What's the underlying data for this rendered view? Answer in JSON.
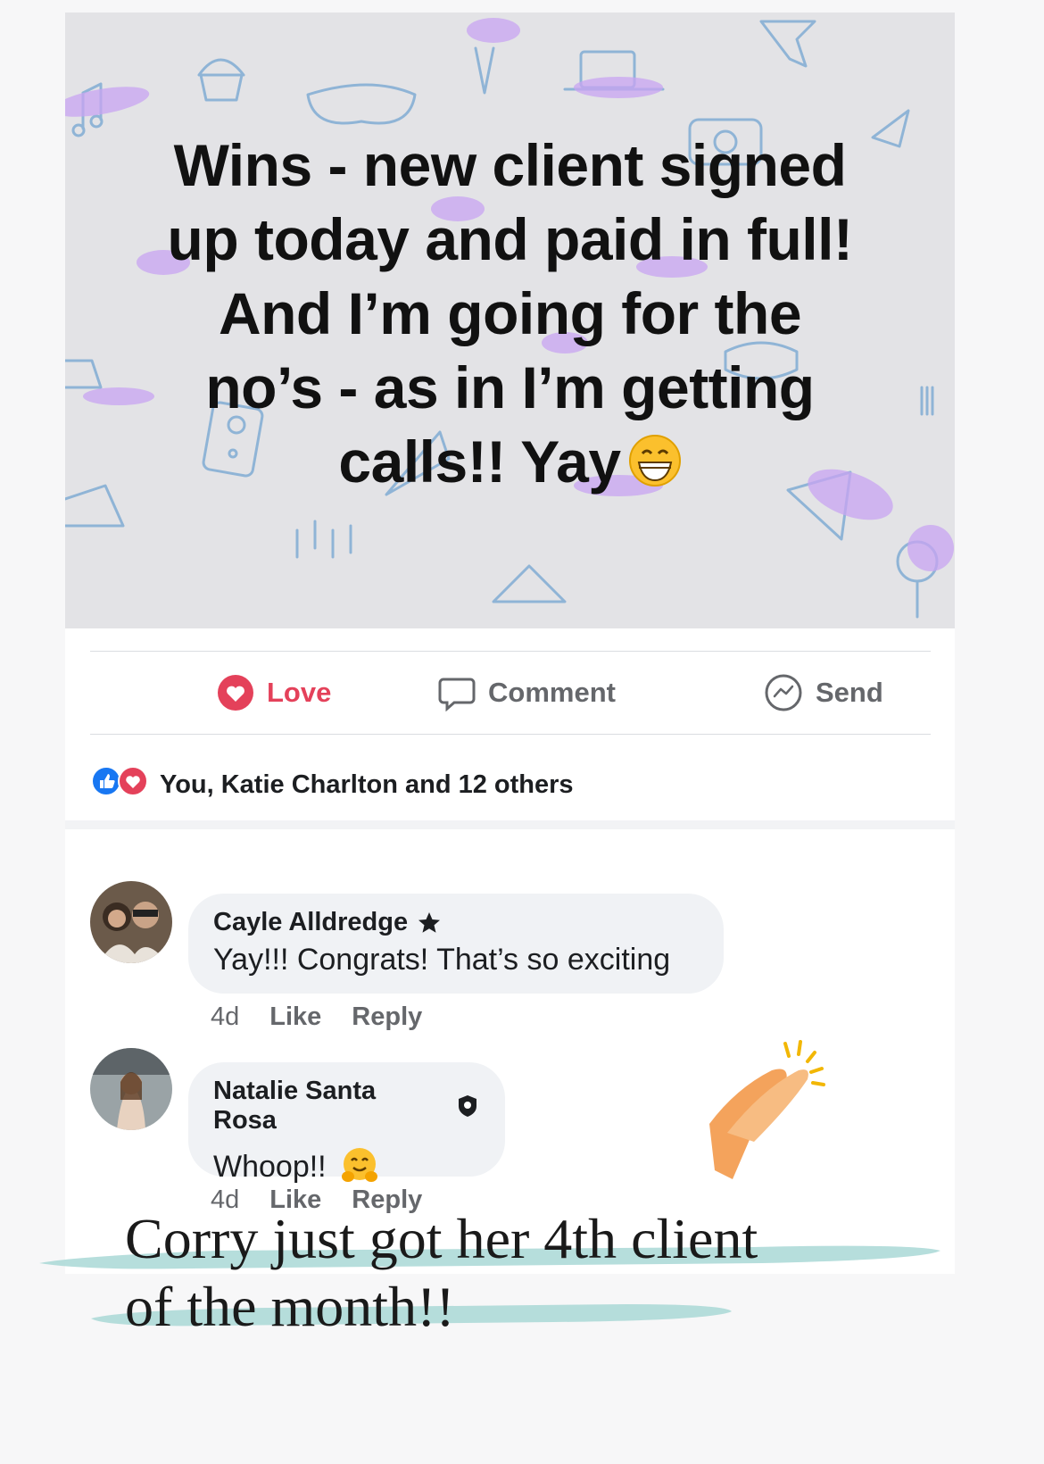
{
  "post": {
    "lines": [
      "Wins - new client signed",
      "up today and paid in full!",
      "And I’m going for the",
      "no’s - as in I’m getting",
      "calls!! Yay"
    ],
    "end_emoji": "grinning-face-with-smiling-eyes"
  },
  "actions": {
    "love": "Love",
    "comment": "Comment",
    "send": "Send"
  },
  "reactions": {
    "text": "You, Katie Charlton and 12 others",
    "icons": [
      "like-icon",
      "love-icon"
    ]
  },
  "comments": [
    {
      "name": "Cayle Alldredge",
      "badge": "star-icon",
      "text": "Yay!!! Congrats! That’s so exciting",
      "time": "4d",
      "like": "Like",
      "reply": "Reply"
    },
    {
      "name": "Natalie Santa Rosa",
      "badge": "shield-icon",
      "text": "Whoop!!",
      "emoji": "hugging-face",
      "time": "4d",
      "like": "Like",
      "reply": "Reply"
    }
  ],
  "caption": {
    "line1": "Corry just got her 4th client",
    "line2": "of the month!!"
  },
  "colors": {
    "love_red": "#e4415a",
    "like_blue": "#1877f2",
    "highlight_teal": "#a9d8d6",
    "post_bg": "#e3e3e6"
  }
}
